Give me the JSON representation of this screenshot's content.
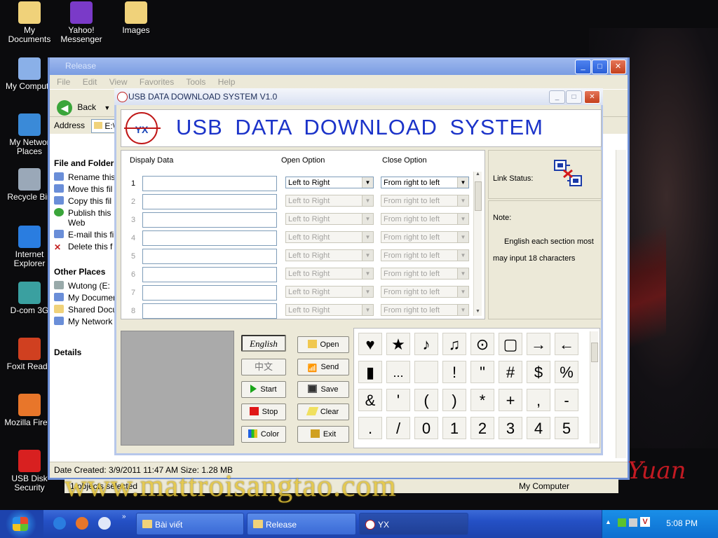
{
  "desktop": {
    "icons": [
      {
        "label": "My\nDocuments"
      },
      {
        "label": "Yahoo!\nMessenger"
      },
      {
        "label": "Images"
      },
      {
        "label": "My Compute"
      },
      {
        "label": "My Networ\nPlaces"
      },
      {
        "label": "Recycle Bin"
      },
      {
        "label": "Internet\nExplorer"
      },
      {
        "label": "D-com 3G"
      },
      {
        "label": "Foxit Reade"
      },
      {
        "label": "Mozilla Firefo"
      },
      {
        "label": "USB Disk\nSecurity"
      }
    ],
    "watermark": "www.mattroisangtao.com",
    "signature": "Yuan"
  },
  "explorer": {
    "title": "Release",
    "menu": [
      "File",
      "Edit",
      "View",
      "Favorites",
      "Tools",
      "Help"
    ],
    "back_label": "Back",
    "address_label": "Address",
    "address_value": "E:\\",
    "file_tasks_heading": "File and Folder",
    "file_tasks": [
      "Rename this",
      "Move this fil",
      "Copy this fil",
      "Publish this",
      "Web",
      "E-mail this fil",
      "Delete this f"
    ],
    "other_places_heading": "Other Places",
    "other_places": [
      "Wutong (E:",
      "My Documen",
      "Shared Docu",
      "My Network"
    ],
    "details_heading": "Details",
    "status": "Date Created: 3/9/2011 11:47 AM Size: 1.28 MB",
    "status2": "1 objects selected",
    "status3": "My Computer"
  },
  "app": {
    "title": "USB DATA DOWNLOAD SYSTEM V1.0",
    "banner_title": "USB DATA DOWNLOAD SYSTEM",
    "logo_text": "YX",
    "headers": {
      "display": "Dispaly Data",
      "open": "Open Option",
      "close": "Close Option"
    },
    "rows": [
      {
        "num": "1",
        "open": "Left to Right",
        "close": "From right to left",
        "enabled": true
      },
      {
        "num": "2",
        "open": "Left to Right",
        "close": "From right to left",
        "enabled": false
      },
      {
        "num": "3",
        "open": "Left to Right",
        "close": "From right to left",
        "enabled": false
      },
      {
        "num": "4",
        "open": "Left to Right",
        "close": "From right to left",
        "enabled": false
      },
      {
        "num": "5",
        "open": "Left to Right",
        "close": "From right to left",
        "enabled": false
      },
      {
        "num": "6",
        "open": "Left to Right",
        "close": "From right to left",
        "enabled": false
      },
      {
        "num": "7",
        "open": "Left to Right",
        "close": "From right to left",
        "enabled": false
      },
      {
        "num": "8",
        "open": "Left to Right",
        "close": "From right to left",
        "enabled": false
      }
    ],
    "link_status_label": "Link Status:",
    "note_label": "Note:",
    "note_text": "English each section most may input 18 characters",
    "buttons": {
      "english": "English",
      "chinese": "中文",
      "start": "Start",
      "stop": "Stop",
      "color": "Color",
      "open": "Open",
      "send": "Send",
      "save": "Save",
      "clear": "Clear",
      "exit": "Exit"
    },
    "symbols": [
      "♥",
      "★",
      "♪",
      "♫",
      "⊙",
      "▢",
      "→",
      "←",
      "▮",
      "...",
      "",
      "!",
      "\"",
      "#",
      "$",
      "%",
      "&",
      "'",
      "(",
      ")",
      "*",
      "+",
      ",",
      "-",
      ".",
      "/",
      "0",
      "1",
      "2",
      "3",
      "4",
      "5"
    ]
  },
  "taskbar": {
    "items": [
      "Bài viết",
      "Release",
      "YX"
    ],
    "clock": "5:08 PM"
  }
}
